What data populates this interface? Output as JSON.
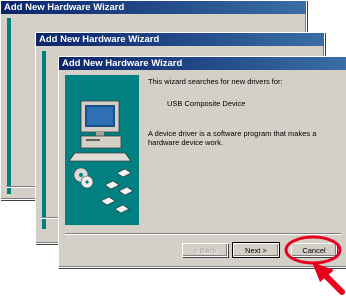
{
  "windows": [
    {
      "title": "Add New Hardware Wizard"
    },
    {
      "title": "Add New Hardware Wizard"
    },
    {
      "title": "Add New Hardware Wizard"
    }
  ],
  "wizard": {
    "line1": "This wizard searches for new drivers for:",
    "device": "USB Composite Device",
    "line3a": "A device driver is a software program that makes a",
    "line3b": "hardware device work."
  },
  "buttons": {
    "back": "< Back",
    "next": "Next >",
    "cancel": "Cancel"
  },
  "colors": {
    "titlebar": "#0a246a",
    "panel": "#008080",
    "face": "#d4d0c8",
    "annotation": "#e8001c"
  },
  "icons": [
    "computer-icon",
    "disc-icon",
    "floppy-disk-icon"
  ]
}
